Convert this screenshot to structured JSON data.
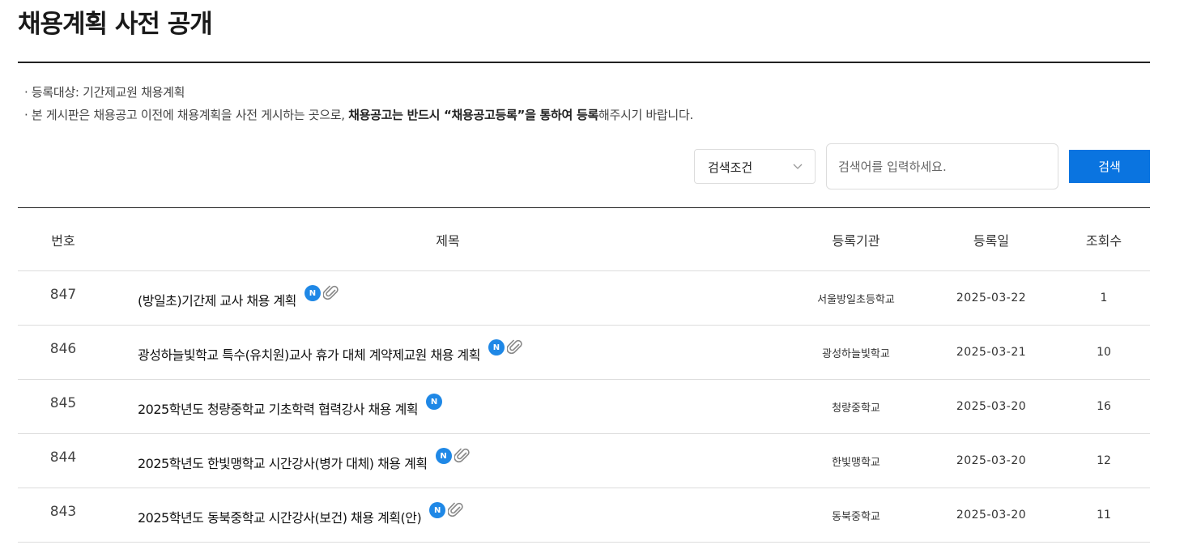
{
  "page": {
    "title": "채용계획 사전 공개"
  },
  "notice": {
    "line1": "· 등록대상: 기간제교원 채용계획",
    "line2_pre": "· 본 게시판은 채용공고 이전에 채용계획을 사전 게시하는 곳으로, ",
    "line2_bold1": "채용공고는 반드시 “채용공고등록”을 통하여 등록",
    "line2_post": "해주시기 바랍니다."
  },
  "search": {
    "condition_label": "검색조건",
    "placeholder": "검색어를 입력하세요.",
    "button_label": "검색"
  },
  "table": {
    "headers": {
      "no": "번호",
      "title": "제목",
      "org": "등록기관",
      "date": "등록일",
      "views": "조회수"
    },
    "rows": [
      {
        "no": "847",
        "title": "(방일초)기간제 교사 채용 계획",
        "badge": "N",
        "attachment": true,
        "org": "서울방일초등학교",
        "date": "2025-03-22",
        "views": "1"
      },
      {
        "no": "846",
        "title": "광성하늘빛학교 특수(유치원)교사 휴가 대체 계약제교원 채용 계획",
        "badge": "N",
        "attachment": true,
        "org": "광성하늘빛학교",
        "date": "2025-03-21",
        "views": "10"
      },
      {
        "no": "845",
        "title": "2025학년도 청량중학교 기초학력 협력강사 채용 계획",
        "badge": "N",
        "attachment": false,
        "org": "청량중학교",
        "date": "2025-03-20",
        "views": "16"
      },
      {
        "no": "844",
        "title": "2025학년도 한빛맹학교 시간강사(병가 대체) 채용 계획",
        "badge": "N",
        "attachment": true,
        "org": "한빛맹학교",
        "date": "2025-03-20",
        "views": "12"
      },
      {
        "no": "843",
        "title": "2025학년도 동북중학교 시간강사(보건) 채용 계획(안)",
        "badge": "N",
        "attachment": true,
        "org": "동북중학교",
        "date": "2025-03-20",
        "views": "11"
      }
    ]
  },
  "icons": {
    "badge": "new-badge-icon",
    "attachment": "paperclip-icon",
    "select": "chevron-down-icon"
  },
  "colors": {
    "accent": "#0a74e0",
    "badge": "#1f88e6",
    "rule": "#222222",
    "divider": "#dddddd"
  }
}
